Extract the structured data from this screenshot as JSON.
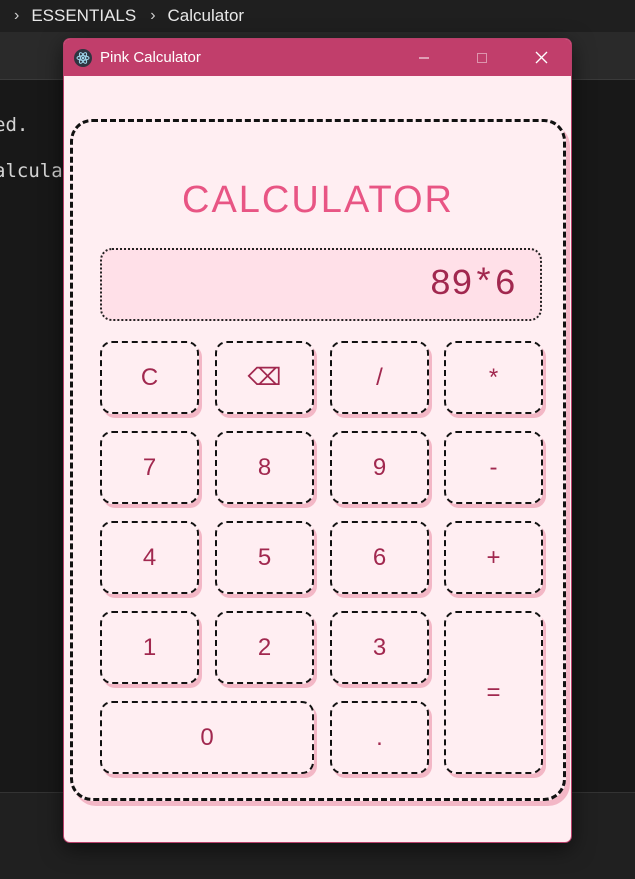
{
  "background": {
    "breadcrumb": [
      "ESSENTIALS",
      "Calculator"
    ],
    "breadcrumb_sep": "›",
    "code_lines": [
      "ed.",
      "alcula"
    ]
  },
  "window": {
    "title": "Pink Calculator",
    "minimize_glyph": "—",
    "maximize_glyph": "☐",
    "close_glyph": "✕"
  },
  "calculator": {
    "heading": "CALCULATOR",
    "display_value": "89*6",
    "keys": {
      "clear": "C",
      "backspace": "⌫",
      "divide": "/",
      "multiply": "*",
      "seven": "7",
      "eight": "8",
      "nine": "9",
      "subtract": "-",
      "four": "4",
      "five": "5",
      "six": "6",
      "add": "+",
      "one": "1",
      "two": "2",
      "three": "3",
      "equals": "=",
      "zero": "0",
      "decimal": "."
    }
  },
  "colors": {
    "titlebar": "#c13e6b",
    "window_bg": "#ffeef2",
    "accent_text": "#a1284f",
    "heading": "#e85584",
    "display_bg": "#ffe0e8",
    "key_shadow": "#f3b7c6"
  },
  "icons": {
    "app": "electron-atom-icon"
  }
}
